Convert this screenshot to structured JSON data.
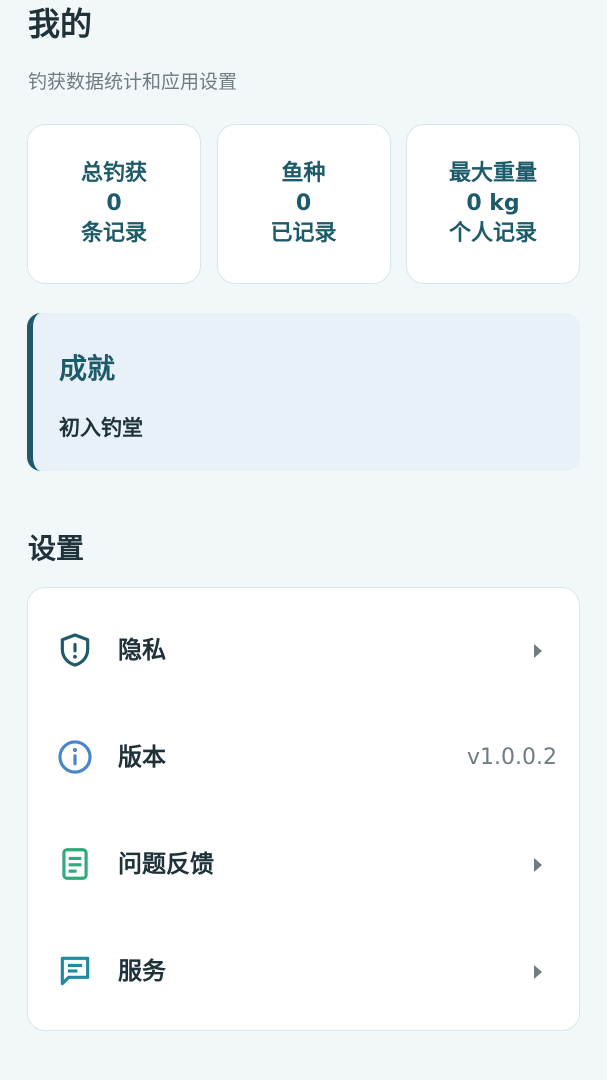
{
  "header": {
    "title": "我的",
    "subtitle": "钓获数据统计和应用设置"
  },
  "stats": [
    {
      "label": "总钓获",
      "value": "0",
      "note": "条记录"
    },
    {
      "label": "鱼种",
      "value": "0",
      "note": "已记录"
    },
    {
      "label": "最大重量",
      "value": "0 kg",
      "note": "个人记录"
    }
  ],
  "achievement": {
    "title": "成就",
    "value": "初入钓堂"
  },
  "settings": {
    "title": "设置",
    "items": [
      {
        "label": "隐私",
        "icon": "shield-icon",
        "color": "#1d5b6b"
      },
      {
        "label": "版本",
        "icon": "info-icon",
        "value": "v1.0.0.2",
        "color": "#4a86c5"
      },
      {
        "label": "问题反馈",
        "icon": "document-icon",
        "color": "#2faa7a"
      },
      {
        "label": "服务",
        "icon": "chat-icon",
        "color": "#1f8aa0"
      }
    ]
  },
  "colors": {
    "accent": "#1d5b6b",
    "background": "#f2f7fa"
  }
}
